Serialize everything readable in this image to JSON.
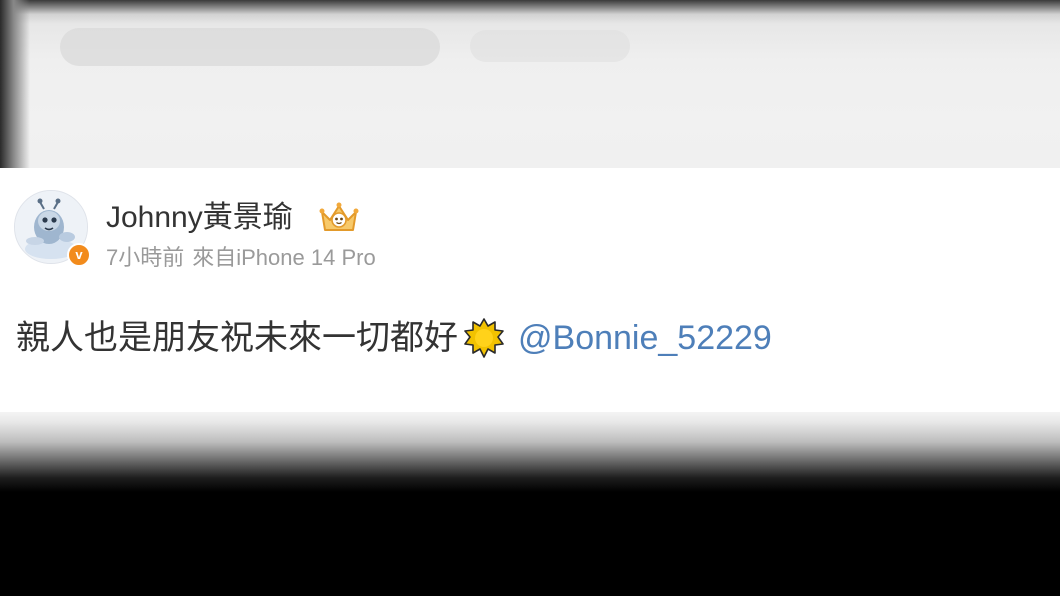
{
  "post": {
    "username": "Johnny黃景瑜",
    "member_badge_icon": "vip-crown-icon",
    "verify_badge_text": "v",
    "time": "7小時前",
    "source": "來自iPhone 14 Pro",
    "content_text": "親人也是朋友祝未來一切都好",
    "emoji": "sun-icon",
    "mention": "@Bonnie_52229"
  },
  "colors": {
    "text": "#333333",
    "meta": "#9a9a9a",
    "mention": "#4e7fb9",
    "verify_badge": "#f28b1c",
    "sun": "#f2c200"
  }
}
